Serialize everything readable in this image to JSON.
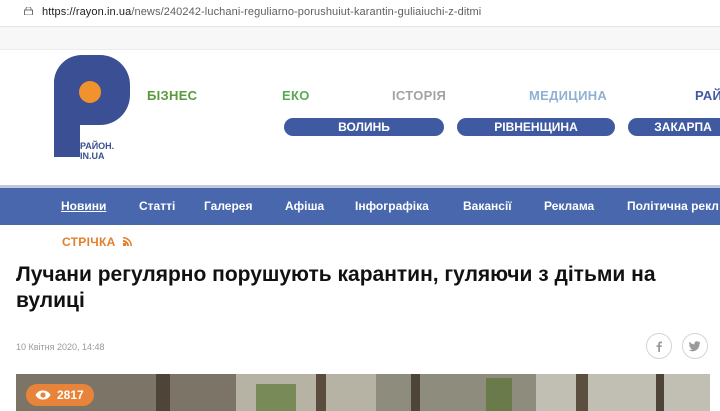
{
  "browser": {
    "url_host": "https://rayon.in.ua",
    "url_path": "/news/240242-luchani-reguliarno-porushuiut-karantin-guliaiuchi-z-ditmi"
  },
  "logo": {
    "line1": "РАЙОН.",
    "line2": "IN.UA"
  },
  "categories": [
    {
      "label": "БІЗНЕС",
      "color": "#5a9a3a"
    },
    {
      "label": "ЕКО",
      "color": "#5aaa55"
    },
    {
      "label": "ІСТОРІЯ",
      "color": "#a3a3a3"
    },
    {
      "label": "МЕДИЦИНА",
      "color": "#8fb1d4"
    },
    {
      "label": "РАЙ",
      "color": "#3f5aa1"
    }
  ],
  "regions": [
    "ВОЛИНЬ",
    "РІВНЕНЩИНА",
    "ЗАКАРПА"
  ],
  "nav": [
    "Новини",
    "Статті",
    "Галерея",
    "Афіша",
    "Інфографіка",
    "Вакансії",
    "Реклама",
    "Політична рекл"
  ],
  "stream_label": "СТРІЧКА",
  "article": {
    "title": "Лучани регулярно порушують карантин, гуляючи з дітьми на вулиці",
    "date": "10 Квітня 2020, 14:48",
    "views": "2817"
  },
  "colors": {
    "brand_blue": "#4867ac",
    "accent_orange": "#e8843a"
  }
}
